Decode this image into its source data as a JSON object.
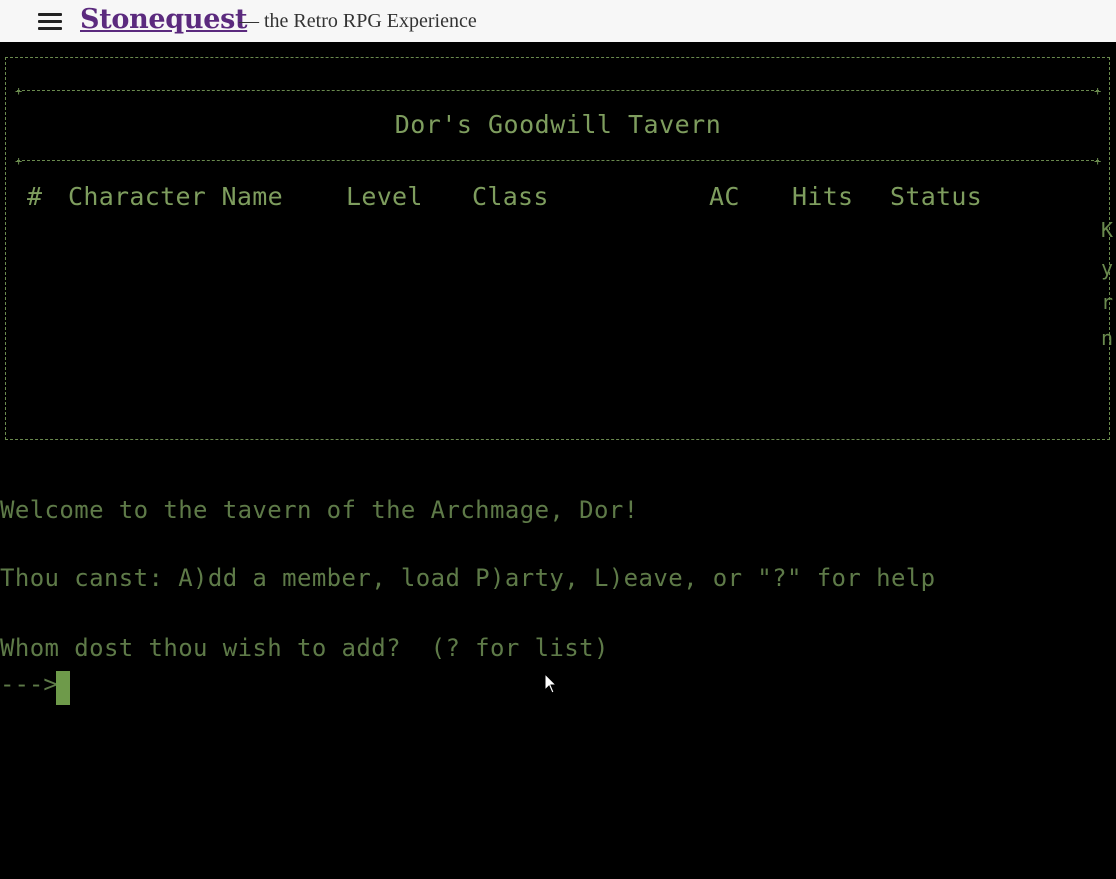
{
  "header": {
    "brand": "Stonequest",
    "tagline": "— the Retro RPG Experience",
    "menu_icon": "hamburger-menu-icon"
  },
  "tavern": {
    "title": "Dor's Goodwill Tavern",
    "columns": {
      "number": "#",
      "name": "Character Name",
      "level": "Level",
      "class": "Class",
      "ac": "AC",
      "hits": "Hits",
      "status": "Status"
    },
    "rows": [],
    "side_letters": [
      "K",
      "y",
      "r",
      "n"
    ]
  },
  "console": {
    "welcome": "Welcome to the tavern of the Archmage, Dor!",
    "options": "Thou canst: A)dd a member, load P)arty, L)eave, or \"?\" for help",
    "question": "Whom dost thou wish to add?  (? for list)",
    "prompt": "--->",
    "input_value": ""
  },
  "colors": {
    "phosphor_bright": "#7e9d5e",
    "phosphor_dim": "#5e7a48",
    "cursor": "#6e9a4a",
    "brand": "#5b2a7e"
  }
}
